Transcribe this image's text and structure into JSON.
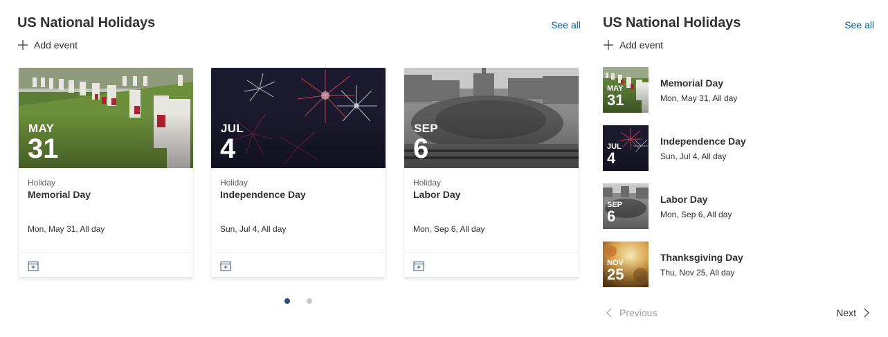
{
  "filmstrip": {
    "title": "US National Holidays",
    "see_all": "See all",
    "add_event": "Add event",
    "cards": [
      {
        "month": "MAY",
        "day": "31",
        "category": "Holiday",
        "name": "Memorial Day",
        "when": "Mon, May 31, All day"
      },
      {
        "month": "JUL",
        "day": "4",
        "category": "Holiday",
        "name": "Independence Day",
        "when": "Sun, Jul 4, All day"
      },
      {
        "month": "SEP",
        "day": "6",
        "category": "Holiday",
        "name": "Labor Day",
        "when": "Mon, Sep 6, All day"
      }
    ],
    "pagination": {
      "pages": 2,
      "active": 1
    }
  },
  "compact": {
    "title": "US National Holidays",
    "see_all": "See all",
    "add_event": "Add event",
    "items": [
      {
        "month": "MAY",
        "day": "31",
        "name": "Memorial Day",
        "when": "Mon, May 31, All day"
      },
      {
        "month": "JUL",
        "day": "4",
        "name": "Independence Day",
        "when": "Sun, Jul 4, All day"
      },
      {
        "month": "SEP",
        "day": "6",
        "name": "Labor Day",
        "when": "Mon, Sep 6, All day"
      },
      {
        "month": "NOV",
        "day": "25",
        "name": "Thanksgiving Day",
        "when": "Thu, Nov 25, All day"
      }
    ],
    "pager": {
      "previous": "Previous",
      "next": "Next"
    }
  },
  "colors": {
    "link": "#0f5c8e",
    "accent": "#2b4c7e",
    "text": "#323130"
  },
  "icons": [
    "plus-icon",
    "calendar-add-icon",
    "chevron-left-icon",
    "chevron-right-icon"
  ]
}
